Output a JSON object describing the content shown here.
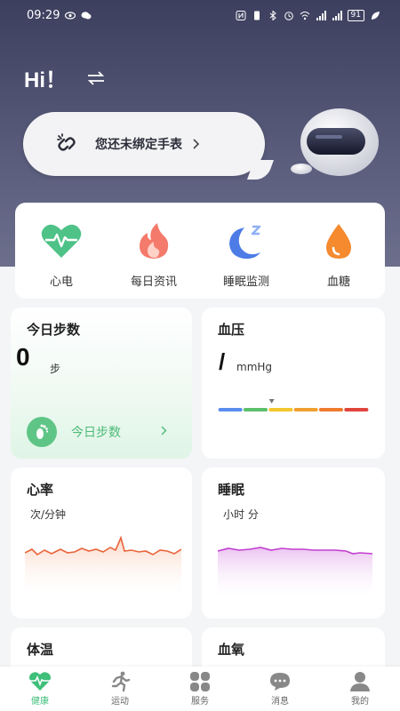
{
  "status_bar": {
    "time": "09:29",
    "battery": "91"
  },
  "header": {
    "greeting": "Hi！",
    "bind_watch": "您还未绑定手表"
  },
  "features": [
    {
      "label": "心电",
      "icon": "heart-ecg-icon"
    },
    {
      "label": "每日资讯",
      "icon": "flame-icon"
    },
    {
      "label": "睡眠监测",
      "icon": "moon-sleep-icon"
    },
    {
      "label": "血糖",
      "icon": "blood-drop-icon"
    }
  ],
  "steps": {
    "title": "今日步数",
    "value": "0",
    "unit": "步",
    "button": "今日步数"
  },
  "blood_pressure": {
    "title": "血压",
    "value": "/",
    "unit": "mmHg",
    "scale_colors": [
      "#5b8def",
      "#5cbf6b",
      "#f3c62d",
      "#f0a030",
      "#ef7b2f",
      "#e0443b"
    ]
  },
  "heart_rate": {
    "title": "心率",
    "unit": "次/分钟",
    "line_color": "#e8643a"
  },
  "sleep": {
    "title": "睡眠",
    "unit": "小时 分",
    "line_color": "#c23fd0"
  },
  "temperature": {
    "title": "体温"
  },
  "spo2": {
    "title": "血氧"
  },
  "nav": [
    {
      "label": "健康",
      "icon": "heart-pulse-icon",
      "active": true
    },
    {
      "label": "运动",
      "icon": "running-icon",
      "active": false
    },
    {
      "label": "服务",
      "icon": "grid-icon",
      "active": false
    },
    {
      "label": "消息",
      "icon": "chat-icon",
      "active": false
    },
    {
      "label": "我的",
      "icon": "user-icon",
      "active": false
    }
  ]
}
